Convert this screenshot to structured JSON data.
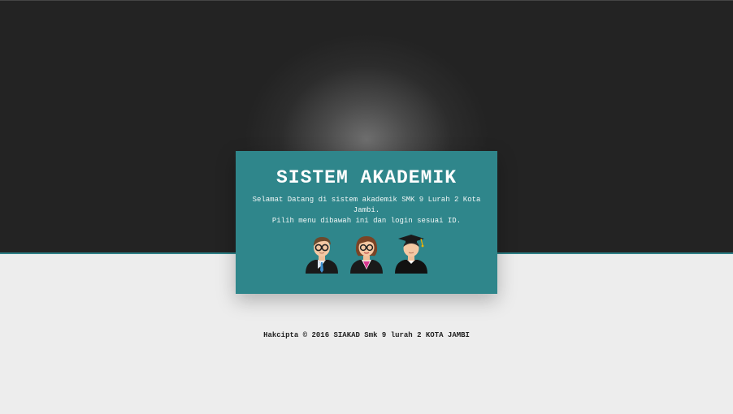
{
  "card": {
    "title": "SISTEM AKADEMIK",
    "welcome_line1": "Selamat Datang di sistem akademik SMK 9 Lurah 2 Kota Jambi.",
    "welcome_line2": "Pilih menu dibawah ini dan login sesuai ID."
  },
  "roles": [
    {
      "icon": "admin-avatar-icon"
    },
    {
      "icon": "teacher-avatar-icon"
    },
    {
      "icon": "student-avatar-icon"
    }
  ],
  "footer": {
    "copyright": "Hakcipta © 2016 SIAKAD Smk 9 lurah 2 KOTA JAMBI"
  },
  "colors": {
    "card_bg": "#2f868b",
    "accent_line": "#2e8087",
    "top_bg": "#232323",
    "bottom_bg": "#ececec"
  }
}
